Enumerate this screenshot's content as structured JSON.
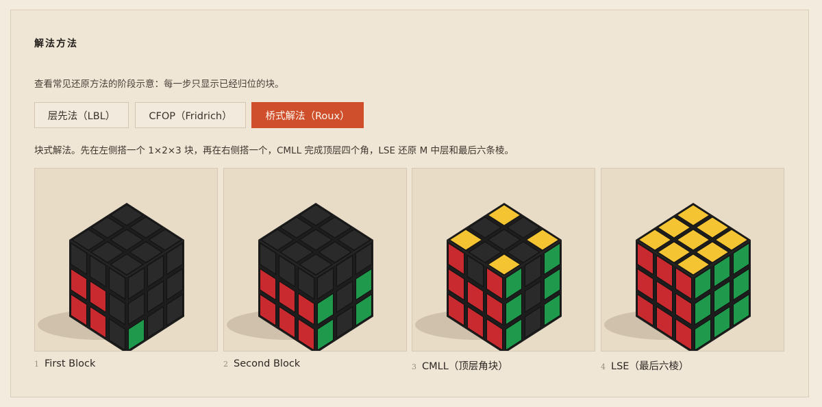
{
  "section": {
    "title": "解法方法"
  },
  "intro": "查看常见还原方法的阶段示意：每一步只显示已经归位的块。",
  "tabs": [
    {
      "label": "层先法（LBL）",
      "active": false
    },
    {
      "label": "CFOP（Fridrich）",
      "active": false
    },
    {
      "label": "桥式解法（Roux）",
      "active": true
    }
  ],
  "description": "块式解法。先在左侧搭一个 1×2×3 块，再在右侧搭一个，CMLL 完成顶层四个角，LSE 还原 M 中层和最后六条棱。",
  "colors": {
    "accent": "#cf4e2b",
    "red": "#c92a2f",
    "green": "#1f9a4c",
    "yellow": "#f4c433",
    "black": "#2a2a2a",
    "cube_body": "#1d1d1d"
  },
  "steps": [
    {
      "number": "1",
      "label": "First Block",
      "cube": {
        "top": [
          "k",
          "k",
          "k",
          "k",
          "k",
          "k",
          "k",
          "k",
          "k"
        ],
        "left": [
          "k",
          "k",
          "k",
          "r",
          "r",
          "k",
          "r",
          "r",
          "k"
        ],
        "right": [
          "k",
          "k",
          "k",
          "k",
          "k",
          "k",
          "g",
          "k",
          "k"
        ]
      }
    },
    {
      "number": "2",
      "label": "Second Block",
      "cube": {
        "top": [
          "k",
          "k",
          "k",
          "k",
          "k",
          "k",
          "k",
          "k",
          "k"
        ],
        "left": [
          "k",
          "k",
          "k",
          "r",
          "r",
          "r",
          "r",
          "r",
          "r"
        ],
        "right": [
          "k",
          "k",
          "k",
          "g",
          "k",
          "g",
          "g",
          "k",
          "g"
        ]
      }
    },
    {
      "number": "3",
      "label": "CMLL（顶层角块）",
      "cube": {
        "top": [
          "y",
          "k",
          "y",
          "k",
          "k",
          "k",
          "y",
          "k",
          "y"
        ],
        "left": [
          "r",
          "k",
          "r",
          "r",
          "r",
          "r",
          "r",
          "r",
          "r"
        ],
        "right": [
          "g",
          "k",
          "g",
          "g",
          "k",
          "g",
          "g",
          "k",
          "g"
        ]
      }
    },
    {
      "number": "4",
      "label": "LSE（最后六棱）",
      "cube": {
        "top": [
          "y",
          "y",
          "y",
          "y",
          "y",
          "y",
          "y",
          "y",
          "y"
        ],
        "left": [
          "r",
          "r",
          "r",
          "r",
          "r",
          "r",
          "r",
          "r",
          "r"
        ],
        "right": [
          "g",
          "g",
          "g",
          "g",
          "g",
          "g",
          "g",
          "g",
          "g"
        ]
      }
    }
  ]
}
